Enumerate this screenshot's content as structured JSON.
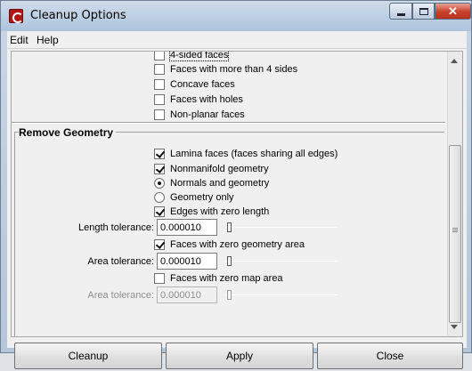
{
  "window": {
    "title": "Cleanup Options"
  },
  "menu": [
    "Edit",
    "Help"
  ],
  "top_group": {
    "options": [
      {
        "label": "4-sided faces",
        "checked": false
      },
      {
        "label": "Faces with more than 4 sides",
        "checked": false
      },
      {
        "label": "Concave faces",
        "checked": false
      },
      {
        "label": "Faces with holes",
        "checked": false
      },
      {
        "label": "Non-planar faces",
        "checked": false
      }
    ]
  },
  "remove_geometry": {
    "title": "Remove Geometry",
    "lamina": {
      "label": "Lamina faces (faces sharing all edges)",
      "checked": true
    },
    "nonmanifold": {
      "label": "Nonmanifold geometry",
      "checked": true
    },
    "normals_and_geometry": {
      "label": "Normals and geometry",
      "selected": true
    },
    "geometry_only": {
      "label": "Geometry only",
      "selected": false
    },
    "zero_length": {
      "label": "Edges with zero length",
      "checked": true
    },
    "length_tolerance": {
      "label": "Length tolerance:",
      "value": "0.000010"
    },
    "zero_geometry_area": {
      "label": "Faces with zero geometry area",
      "checked": true
    },
    "area_tolerance": {
      "label": "Area tolerance:",
      "value": "0.000010"
    },
    "zero_map_area": {
      "label": "Faces with zero map area",
      "checked": false
    },
    "map_area_tolerance": {
      "label": "Area tolerance:",
      "value": "0.000010",
      "enabled": false
    }
  },
  "buttons": {
    "cleanup": "Cleanup",
    "apply": "Apply",
    "close": "Close"
  }
}
